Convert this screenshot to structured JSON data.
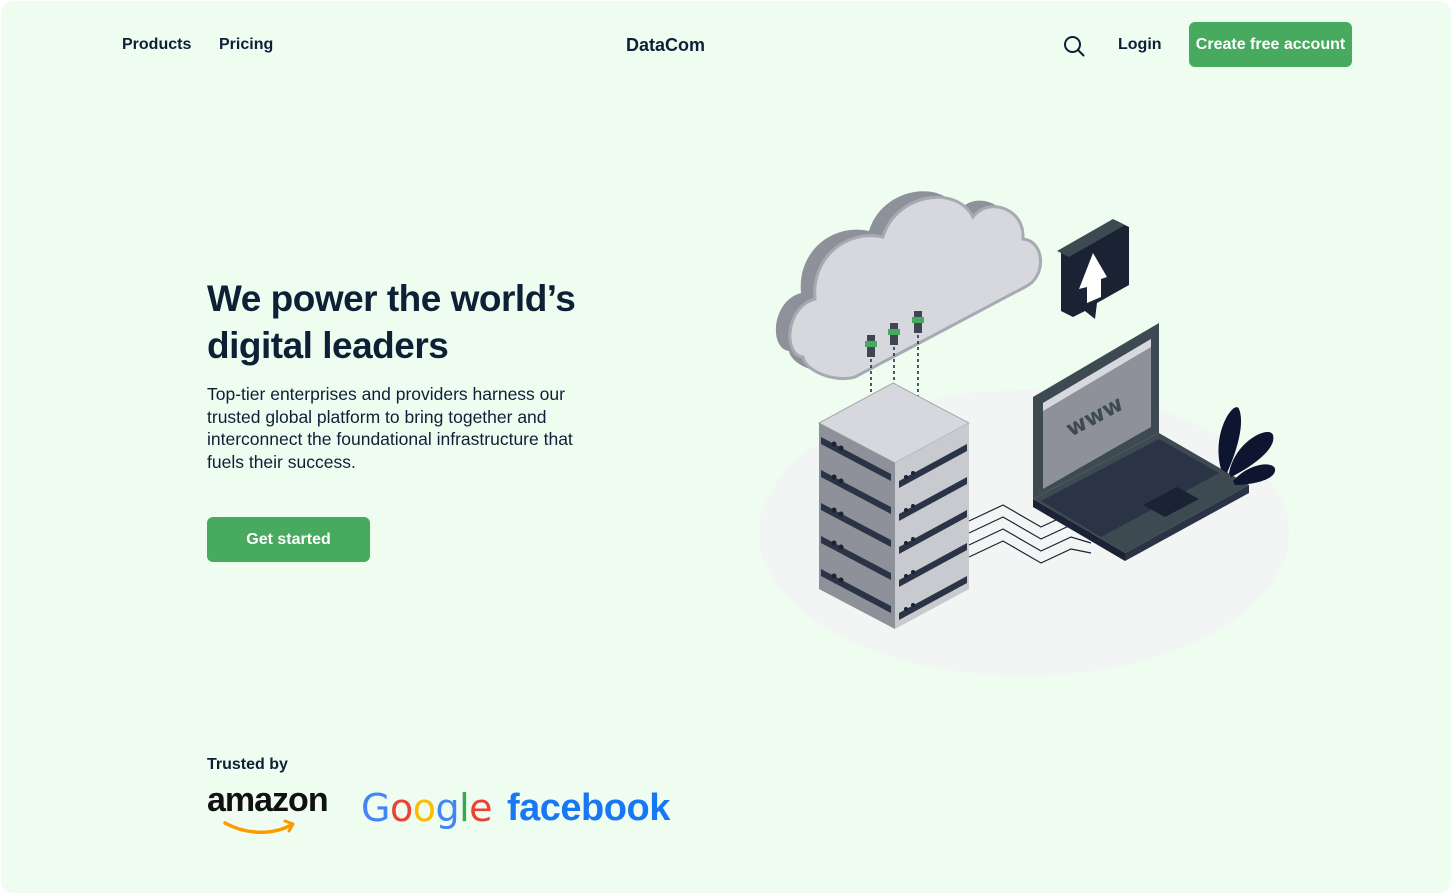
{
  "header": {
    "nav": [
      {
        "label": "Products"
      },
      {
        "label": "Pricing"
      }
    ],
    "brand": "DataCom",
    "login_label": "Login",
    "cta_label": "Create free account"
  },
  "hero": {
    "title": "We power the world’s digital leaders",
    "description": "Top-tier enterprises and providers harness our trusted global platform to bring together and interconnect the foundational infrastructure that fuels their success.",
    "cta_label": "Get started",
    "illustration": {
      "screen_text": "www"
    }
  },
  "trusted": {
    "label": "Trusted by",
    "logos": [
      {
        "name": "amazon",
        "text": "amazon"
      },
      {
        "name": "google",
        "letters": [
          "G",
          "o",
          "o",
          "g",
          "l",
          "e"
        ]
      },
      {
        "name": "facebook",
        "text": "facebook"
      }
    ]
  },
  "colors": {
    "background": "#effdf1",
    "accent": "#47aa5f",
    "text": "#0d2036",
    "google": [
      "#4285f4",
      "#ea4335",
      "#fbbc05",
      "#4285f4",
      "#34a853",
      "#ea4335"
    ],
    "facebook": "#1877f2",
    "amazon_smile": "#ff9900"
  },
  "icons": {
    "search": "search-icon",
    "upload": "upload-arrow-icon"
  }
}
